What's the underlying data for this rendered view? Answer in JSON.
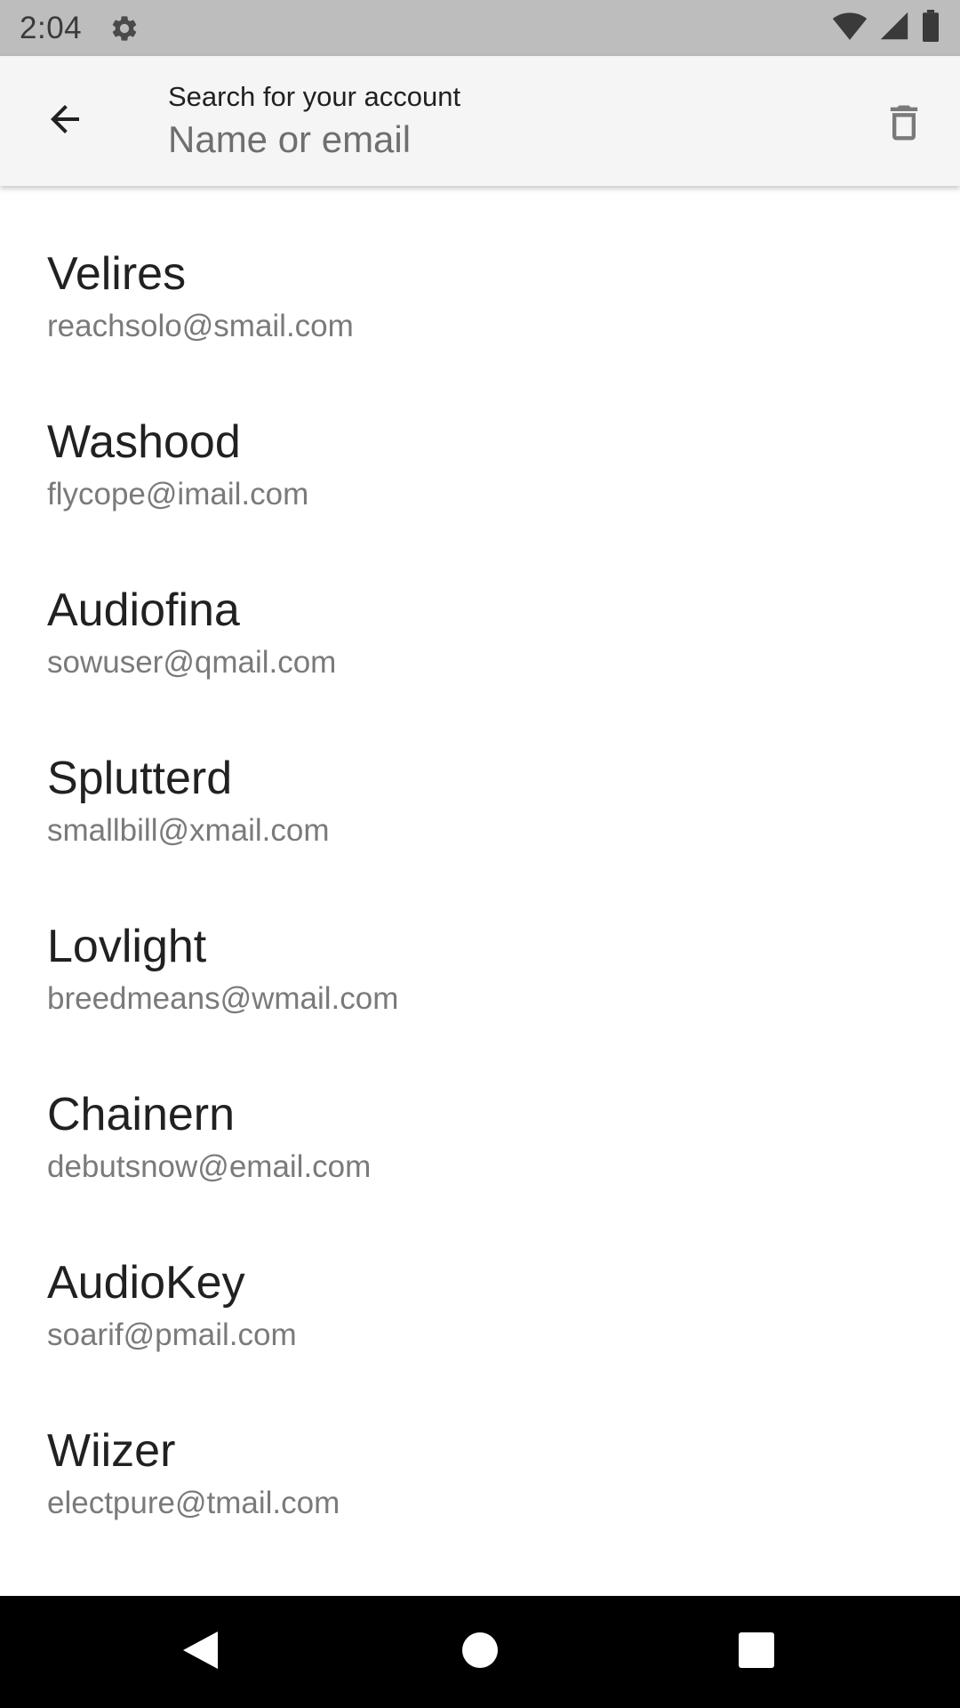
{
  "status_bar": {
    "time": "2:04",
    "icons": [
      "gear-icon",
      "wifi-icon",
      "cellular-signal-icon",
      "battery-icon"
    ]
  },
  "search": {
    "label": "Search for your account",
    "placeholder": "Name or email",
    "value": "",
    "icons": [
      "arrow-back-icon",
      "trash-can-icon"
    ]
  },
  "accounts": [
    {
      "name": "Velires",
      "email": "reachsolo@smail.com"
    },
    {
      "name": "Washood",
      "email": "flycope@imail.com"
    },
    {
      "name": "Audiofina",
      "email": "sowuser@qmail.com"
    },
    {
      "name": "Splutterd",
      "email": "smallbill@xmail.com"
    },
    {
      "name": "Lovlight",
      "email": "breedmeans@wmail.com"
    },
    {
      "name": "Chainern",
      "email": "debutsnow@email.com"
    },
    {
      "name": "AudioKey",
      "email": "soarif@pmail.com"
    },
    {
      "name": "Wiizer",
      "email": "electpure@tmail.com"
    }
  ],
  "nav_bar": {
    "icons": [
      "back-triangle-icon",
      "home-circle-icon",
      "recents-square-icon"
    ]
  },
  "colors": {
    "status_bar_bg": "#bdbdbd",
    "app_bar_bg": "#f5f5f5",
    "primary_text": "#212121",
    "secondary_text": "#7a7a7a",
    "nav_bar_bg": "#000000"
  }
}
